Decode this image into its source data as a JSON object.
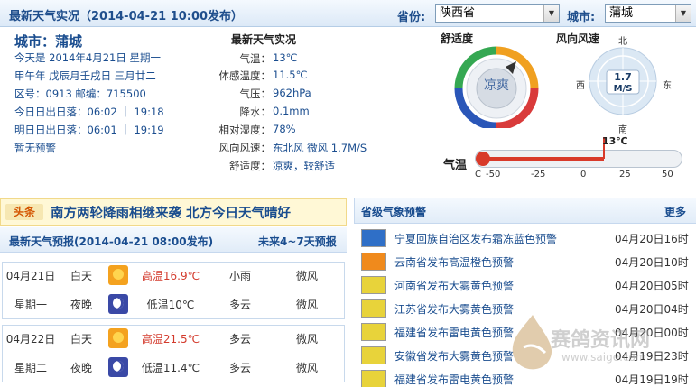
{
  "top": {
    "title": "最新天气实况（2014-04-21 10:00发布）",
    "province_label": "省份:",
    "province_value": "陕西省",
    "city_label": "城市:",
    "city_value": "蒲城"
  },
  "info": {
    "city": "城市：蒲城",
    "lines": [
      "今天是 2014年4月21日 星期一",
      "甲午年 戊辰月壬戌日 三月廿二",
      "区号：0913  邮编：715500",
      "今日日出日落：06:02 ｜ 19:18",
      "明日日出日落：06:01 ｜ 19:19",
      "暂无预警"
    ]
  },
  "observation": {
    "title": "最新天气实况",
    "items": [
      {
        "key": "气温：",
        "value": "13℃"
      },
      {
        "key": "体感温度：",
        "value": "11.5℃"
      },
      {
        "key": "气压：",
        "value": "962hPa"
      },
      {
        "key": "降水：",
        "value": "0.1mm"
      },
      {
        "key": "相对湿度：",
        "value": "78%"
      },
      {
        "key": "风向风速：",
        "value": "东北风 微风 1.7M/S"
      },
      {
        "key": "舒适度：",
        "value": "凉爽，较舒适"
      }
    ]
  },
  "comfort": {
    "label": "舒适度",
    "value": "凉爽"
  },
  "wind": {
    "label": "风向风速",
    "speed": "1.7",
    "unit": "M/S",
    "north": "北",
    "south": "南",
    "east": "东",
    "west": "西"
  },
  "thermometer": {
    "label": "气温",
    "current": "13℃",
    "value": 13,
    "min": -50,
    "max": 50,
    "unit": "C",
    "ticks": [
      "-50",
      "-25",
      "0",
      "25",
      "50"
    ]
  },
  "headline": {
    "tag": "头条",
    "text": "南方两轮降雨相继来袭 北方今日天气晴好"
  },
  "forecast": {
    "title": "最新天气预报(2014-04-21 08:00发布)",
    "link": "未来4~7天预报",
    "days": [
      {
        "date": "04月21日",
        "weekday": "星期一",
        "day": {
          "period": "白天",
          "icon": "light-rain-icon",
          "temp": "高温16.9℃",
          "weather": "小雨",
          "wind": "微风"
        },
        "night": {
          "period": "夜晚",
          "icon": "cloudy-night-icon",
          "temp": "低温10℃",
          "weather": "多云",
          "wind": "微风"
        }
      },
      {
        "date": "04月22日",
        "weekday": "星期二",
        "day": {
          "period": "白天",
          "icon": "partly-cloudy-icon",
          "temp": "高温21.5℃",
          "weather": "多云",
          "wind": "微风"
        },
        "night": {
          "period": "夜晚",
          "icon": "cloudy-night-icon",
          "temp": "低温11.4℃",
          "weather": "多云",
          "wind": "微风"
        }
      }
    ]
  },
  "warnings": {
    "title": "省级气象预警",
    "more": "更多",
    "items": [
      {
        "text": "宁夏回族自治区发布霜冻蓝色预警",
        "date": "04月20日16时",
        "color": "#2f6fc7"
      },
      {
        "text": "云南省发布高温橙色预警",
        "date": "04月20日10时",
        "color": "#f08a1c"
      },
      {
        "text": "河南省发布大雾黄色预警",
        "date": "04月20日05时",
        "color": "#e8d33a"
      },
      {
        "text": "江苏省发布大雾黄色预警",
        "date": "04月20日04时",
        "color": "#e8d33a"
      },
      {
        "text": "福建省发布雷电黄色预警",
        "date": "04月20日00时",
        "color": "#e8d33a"
      },
      {
        "text": "安徽省发布大雾黄色预警",
        "date": "04月19日23时",
        "color": "#e8d33a"
      },
      {
        "text": "福建省发布雷电黄色预警",
        "date": "04月19日19时",
        "color": "#e8d33a"
      }
    ]
  },
  "watermark": {
    "name": "赛鸽资讯网",
    "url": "www.saige.com"
  }
}
